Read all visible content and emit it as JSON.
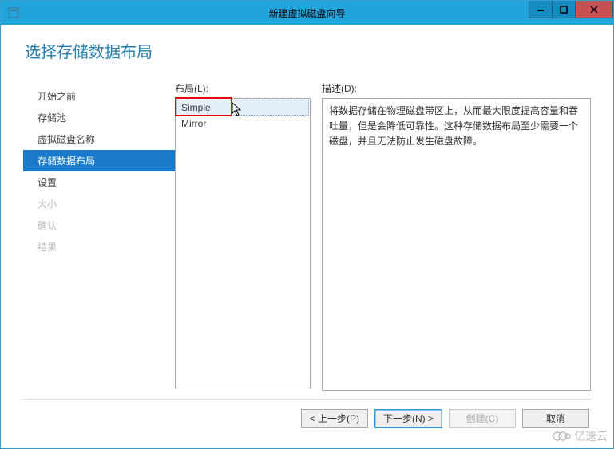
{
  "window": {
    "title": "新建虚拟磁盘向导"
  },
  "heading": "选择存储数据布局",
  "sidebar": {
    "items": [
      {
        "label": "开始之前",
        "state": "normal"
      },
      {
        "label": "存储池",
        "state": "normal"
      },
      {
        "label": "虚拟磁盘名称",
        "state": "normal"
      },
      {
        "label": "存储数据布局",
        "state": "active"
      },
      {
        "label": "设置",
        "state": "normal"
      },
      {
        "label": "大小",
        "state": "disabled"
      },
      {
        "label": "确认",
        "state": "disabled"
      },
      {
        "label": "结果",
        "state": "disabled"
      }
    ]
  },
  "layout_panel": {
    "label": "布局(L):",
    "items": [
      {
        "label": "Simple",
        "selected": true
      },
      {
        "label": "Mirror",
        "selected": false
      }
    ]
  },
  "description_panel": {
    "label": "描述(D):",
    "text": "将数据存储在物理磁盘带区上，从而最大限度提高容量和吞吐量，但是会降低可靠性。这种存储数据布局至少需要一个磁盘，并且无法防止发生磁盘故障。"
  },
  "buttons": {
    "prev": "< 上一步(P)",
    "next": "下一步(N) >",
    "create": "创建(C)",
    "cancel": "取消"
  },
  "watermark": "亿速云"
}
